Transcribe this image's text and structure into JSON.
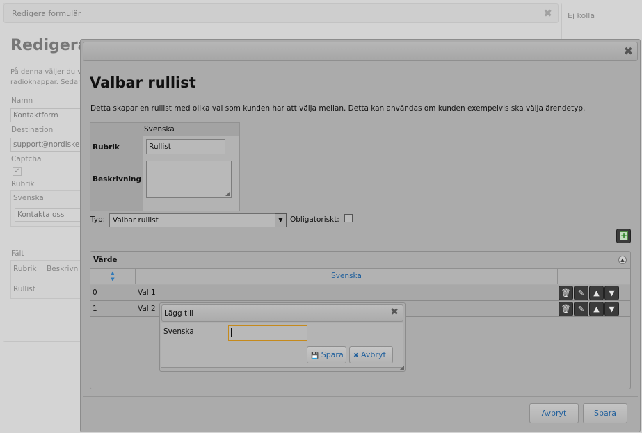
{
  "background": {
    "window_title": "Redigera formulär",
    "right_text": "Ej kolla",
    "heading": "Redigera",
    "desc_line1": "På denna väljer du v",
    "desc_line2": "radioknappar. Sedan",
    "labels": {
      "namn": "Namn",
      "destination": "Destination",
      "captcha": "Captcha",
      "rubrik": "Rubrik",
      "falt": "Fält"
    },
    "values": {
      "namn": "Kontaktform",
      "destination": "support@nordiskeh",
      "rubrik_lang": "Svenska",
      "rubrik_value": "Kontakta oss"
    },
    "captcha_mark": "✓",
    "fields_headers": [
      "Rubrik",
      "Beskrivn"
    ],
    "fields_row": "Rullist"
  },
  "dialog": {
    "close_glyph": "✖",
    "heading": "Valbar rullist",
    "description": "Detta skapar en rullist med olika val som kunden har att välja mellan. Detta kan användas om kunden exempelvis ska välja ärendetyp.",
    "lang_table": {
      "column": "Svenska",
      "rubrik_label": "Rubrik",
      "rubrik_value": "Rullist",
      "beskrivning_label": "Beskrivning",
      "beskrivning_value": ""
    },
    "type": {
      "label": "Typ:",
      "selected": "Valbar rullist",
      "required_label": "Obligatoriskt:",
      "required_checked": false
    },
    "add_glyph": "+",
    "grid": {
      "title": "Värde",
      "column": "Svenska",
      "rows": [
        {
          "index": "0",
          "value": "Val 1"
        },
        {
          "index": "1",
          "value": "Val 2"
        }
      ],
      "actions": [
        {
          "name": "delete-icon",
          "glyph": "🗑"
        },
        {
          "name": "edit-icon",
          "glyph": "✎"
        },
        {
          "name": "move-up-icon",
          "glyph": "▲"
        },
        {
          "name": "move-down-icon",
          "glyph": "▼"
        }
      ]
    },
    "buttons": {
      "cancel": "Avbryt",
      "save": "Spara"
    }
  },
  "inner_dialog": {
    "title": "Lägg till",
    "close_glyph": "✖",
    "field_label": "Svenska",
    "field_value": "",
    "save_label": "Spara",
    "save_glyph": "💾",
    "cancel_label": "Avbryt",
    "cancel_glyph": "✖"
  }
}
